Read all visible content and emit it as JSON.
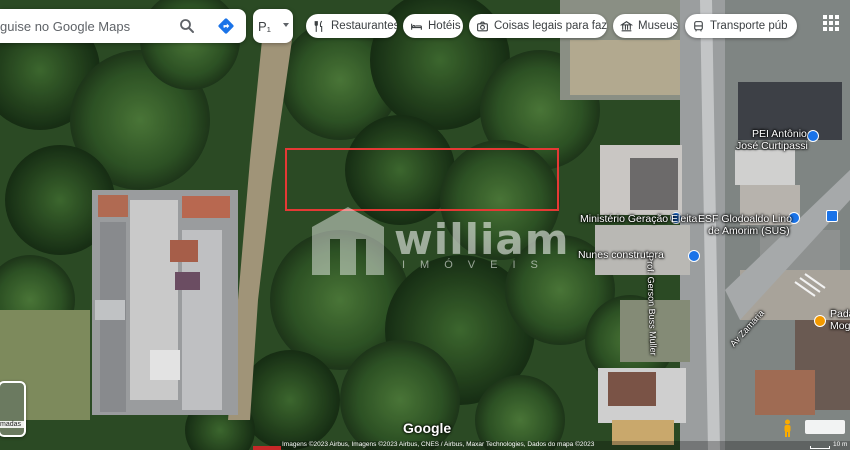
{
  "search": {
    "placeholder": "guise no Google Maps"
  },
  "layers_button": {
    "label": "P₁"
  },
  "chips": [
    {
      "icon": "restaurant-icon",
      "label": "Restaurantes"
    },
    {
      "icon": "hotel-icon",
      "label": "Hotéis"
    },
    {
      "icon": "camera-icon",
      "label": "Coisas legais para faz..."
    },
    {
      "icon": "museum-icon",
      "label": "Museus"
    },
    {
      "icon": "transit-icon",
      "label": "Transporte púb"
    }
  ],
  "places": {
    "pei_antonio": "PEI Antônio",
    "pei_antonio_2": "José Curtipassi",
    "ministerio": "Ministério Geração Eleita",
    "esf": "ESF Glodoaldo Lino",
    "esf_2": "de Amorim (SUS)",
    "nunes": "Nunes construtora",
    "road_1": "Prof. Gerson Buss Muller",
    "road_2": "Av Zamaria",
    "padaria": "Pada",
    "padaria_2": "Mog"
  },
  "watermark": {
    "brand": "william",
    "subtitle": "IMÓVEIS"
  },
  "map_logo": "Google",
  "attribution": "Imagens ©2023 Airbus, Imagens ©2023 Airbus, CNES / Airbus, Maxar Technologies, Dados do mapa ©2023",
  "scale": "10 m",
  "layer_thumb_label": "madas",
  "colors": {
    "highlight": "#e53935",
    "accent": "#1a73e8"
  }
}
